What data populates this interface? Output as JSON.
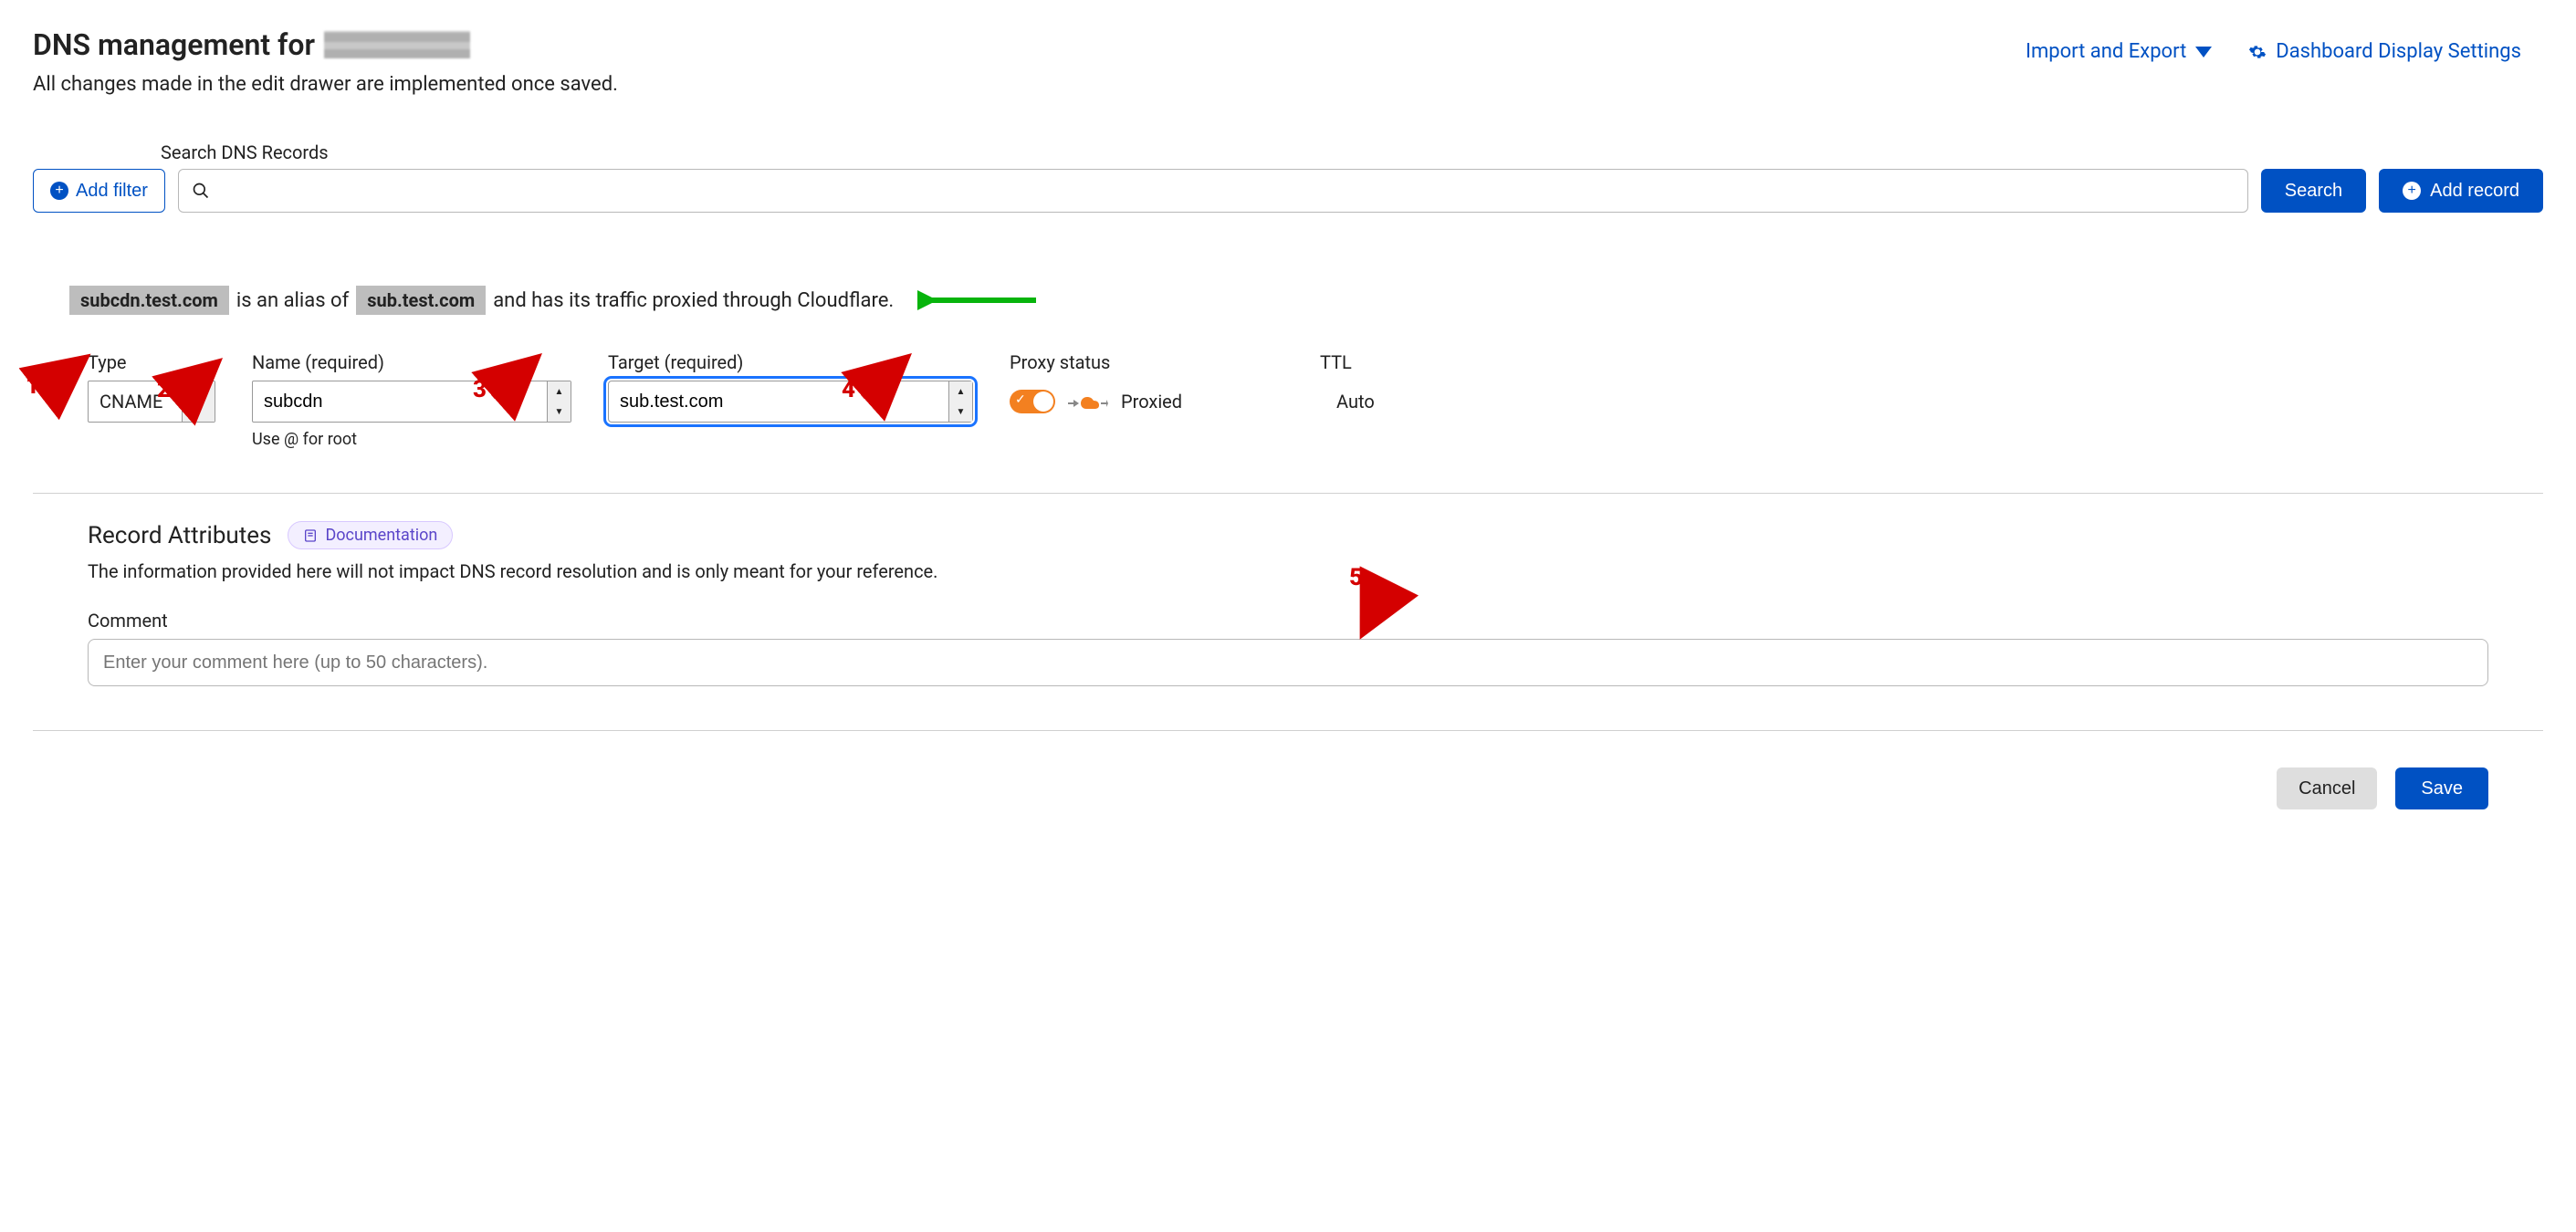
{
  "header": {
    "title_prefix": "DNS management for",
    "subtitle": "All changes made in the edit drawer are implemented once saved.",
    "import_export": "Import and Export",
    "display_settings": "Dashboard Display Settings"
  },
  "toolbar": {
    "add_filter": "Add filter",
    "search_label": "Search DNS Records",
    "search_placeholder": "",
    "search_button": "Search",
    "add_record": "Add record"
  },
  "summary": {
    "host": "subcdn.test.com",
    "mid1": "is an alias of",
    "target": "sub.test.com",
    "tail": "and has its traffic proxied through Cloudflare."
  },
  "form": {
    "labels": {
      "type": "Type",
      "name": "Name (required)",
      "target": "Target (required)",
      "proxy": "Proxy status",
      "ttl": "TTL"
    },
    "values": {
      "type": "CNAME",
      "name": "subcdn",
      "target": "sub.test.com",
      "proxy_label": "Proxied",
      "ttl": "Auto"
    },
    "name_helper": "Use @ for root"
  },
  "attrs": {
    "heading": "Record Attributes",
    "doc_link": "Documentation",
    "description": "The information provided here will not impact DNS record resolution and is only meant for your reference.",
    "comment_label": "Comment",
    "comment_placeholder": "Enter your comment here (up to 50 characters)."
  },
  "footer": {
    "cancel": "Cancel",
    "save": "Save"
  },
  "annotations": {
    "n1": "1",
    "n2": "2",
    "n3": "3",
    "n4": "4",
    "n5": "5"
  }
}
